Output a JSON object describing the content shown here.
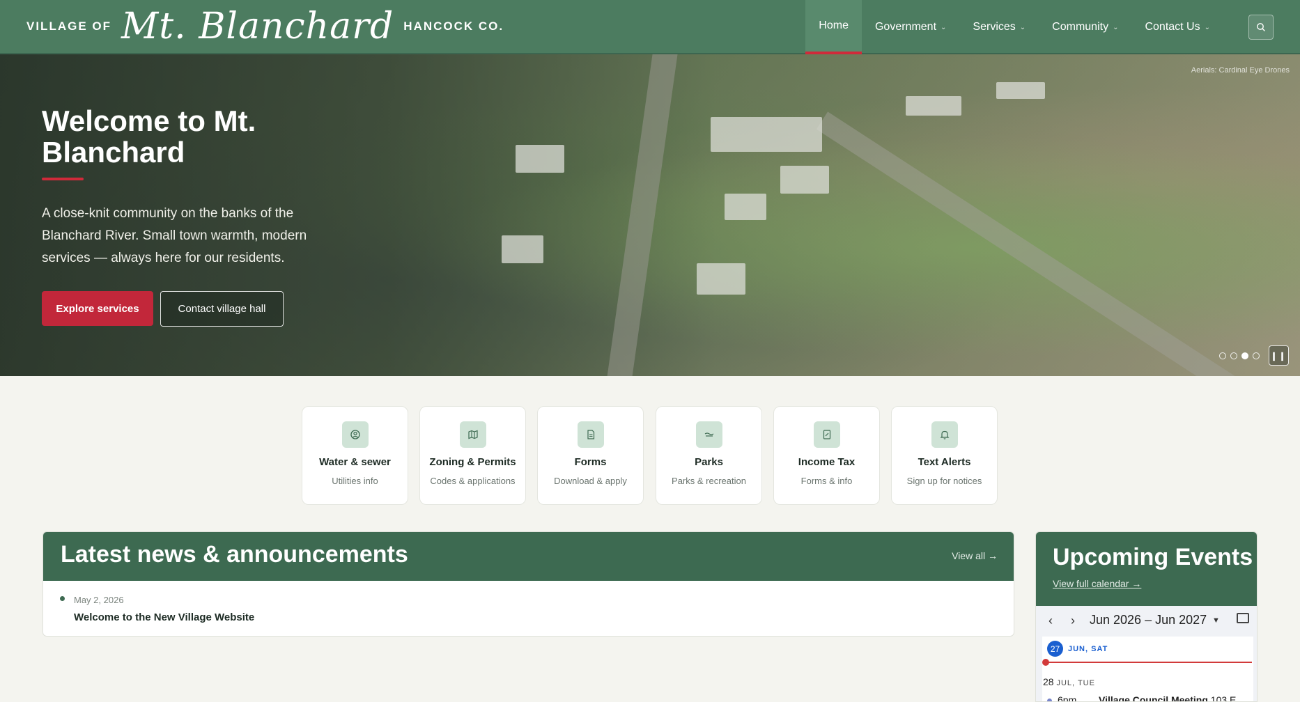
{
  "header": {
    "brand_prefix": "VILLAGE OF",
    "brand_name": "Mt. Blanchard",
    "brand_suffix": "HANCOCK CO.",
    "nav": [
      {
        "label": "Home",
        "active": true
      },
      {
        "label": "Government",
        "has_menu": true
      },
      {
        "label": "Services",
        "has_menu": true
      },
      {
        "label": "Community",
        "has_menu": true
      },
      {
        "label": "Contact Us",
        "has_menu": true
      }
    ],
    "search_icon": "search-icon"
  },
  "hero": {
    "title": "Welcome to Mt. Blanchard",
    "text": "A close-knit community on the banks of the Blanchard River. Small town warmth, modern services — always here for our residents.",
    "primary_button": "Explore services",
    "secondary_button": "Contact village hall",
    "photo_credit": "Aerials: Cardinal Eye Drones",
    "slide_count": 4,
    "active_slide": 3,
    "pause_label": "❙❙"
  },
  "quick_links": [
    {
      "title": "Water & sewer",
      "subtitle": "Utilities info",
      "icon": "water-icon"
    },
    {
      "title": "Zoning & Permits",
      "subtitle": "Codes & applications",
      "icon": "map-icon"
    },
    {
      "title": "Forms",
      "subtitle": "Download & apply",
      "icon": "document-icon"
    },
    {
      "title": "Parks",
      "subtitle": "Parks & recreation",
      "icon": "parks-icon"
    },
    {
      "title": "Income Tax",
      "subtitle": "Forms & info",
      "icon": "tax-icon"
    },
    {
      "title": "Text Alerts",
      "subtitle": "Sign up for notices",
      "icon": "bell-icon"
    }
  ],
  "news": {
    "title": "Latest news & announcements",
    "view_all": "View all →",
    "items": [
      {
        "date": "May 2, 2026",
        "title": "Welcome to the New Village Website"
      }
    ]
  },
  "events": {
    "title": "Upcoming Events",
    "calendar_link": "View full calendar →",
    "calendar": {
      "range": "Jun 2026 – Jun 2027",
      "today_day": "27",
      "today_label": "JUN, SAT",
      "next_day": "28",
      "next_label": "JUL, TUE",
      "event_time": "6pm",
      "event_title": "Village Council Meeting",
      "event_location": "103 E ..."
    }
  },
  "colors": {
    "header_green": "#4c7c60",
    "section_green": "#3d6a51",
    "accent_red": "#c2273a",
    "icon_tile": "#cfe3d6",
    "calendar_blue": "#1a5fd0"
  }
}
